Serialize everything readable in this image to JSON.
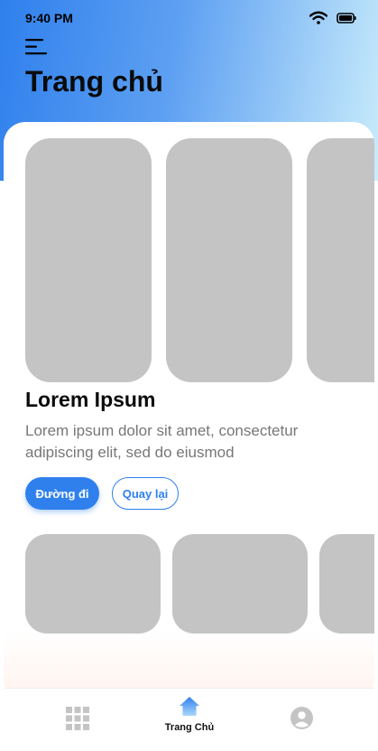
{
  "status_bar": {
    "time": "9:40 PM",
    "icons": [
      "wifi-icon",
      "battery-icon"
    ]
  },
  "header": {
    "title": "Trang chủ",
    "menu_icon": "menu-icon"
  },
  "featured": {
    "title": "Lorem Ipsum",
    "description": "Lorem ipsum dolor sit amet, consectetur adipiscing elit, sed do eiusmod",
    "primary_button": "Đường đi",
    "secondary_button": "Quay lại"
  },
  "bottom_nav": {
    "items": [
      {
        "icon": "grid-icon",
        "label": ""
      },
      {
        "icon": "home-icon",
        "label": "Trang Chủ"
      },
      {
        "icon": "user-icon",
        "label": ""
      }
    ]
  },
  "colors": {
    "accent": "#2f80ed",
    "placeholder": "#c4c4c4",
    "header_gradient_end": "#c9ecfb"
  }
}
